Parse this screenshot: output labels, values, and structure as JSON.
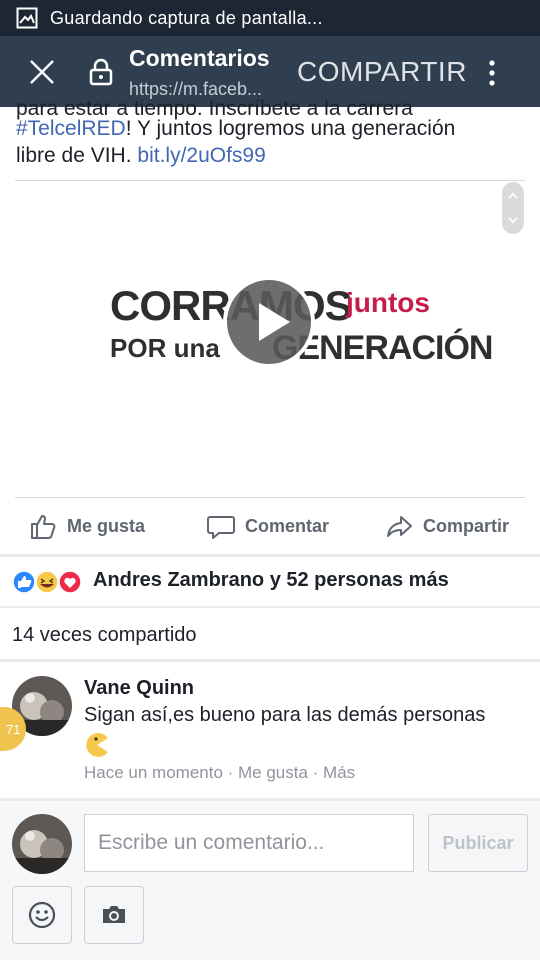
{
  "status_bar": {
    "text": "Guardando captura de pantalla..."
  },
  "app_bar": {
    "title": "Comentarios",
    "url": "https://m.faceb...",
    "share_label": "COMPARTIR"
  },
  "post": {
    "clipped_line": "para estar a tiempo. Inscríbete a la carrera",
    "hashtag": "#TelcelRED",
    "line1_rest": "! Y juntos logremos una generación",
    "line2_text": "libre de VIH. ",
    "link": "bit.ly/2uOfs99"
  },
  "video": {
    "banner_corramos": "CORRAMOS",
    "banner_juntos": "juntos",
    "banner_por_una": "POR una",
    "banner_generacion": "GENERACIÓN"
  },
  "actions": {
    "like": "Me gusta",
    "comment": "Comentar",
    "share": "Compartir"
  },
  "reactions": {
    "text": "Andres Zambrano y 52 personas más"
  },
  "shares": {
    "text": "14 veces compartido"
  },
  "comment": {
    "author": "Vane Quinn",
    "text": "Sigan así,es bueno para las demás personas",
    "meta": "Hace un momento · Me gusta · Más",
    "side_badge": "71"
  },
  "composer": {
    "placeholder": "Escribe un comentario...",
    "publish_label": "Publicar"
  },
  "colors": {
    "status_bar": "#1d2733",
    "app_bar": "#303f4f",
    "link": "#4267b2",
    "accent_red": "#c51d4a"
  }
}
